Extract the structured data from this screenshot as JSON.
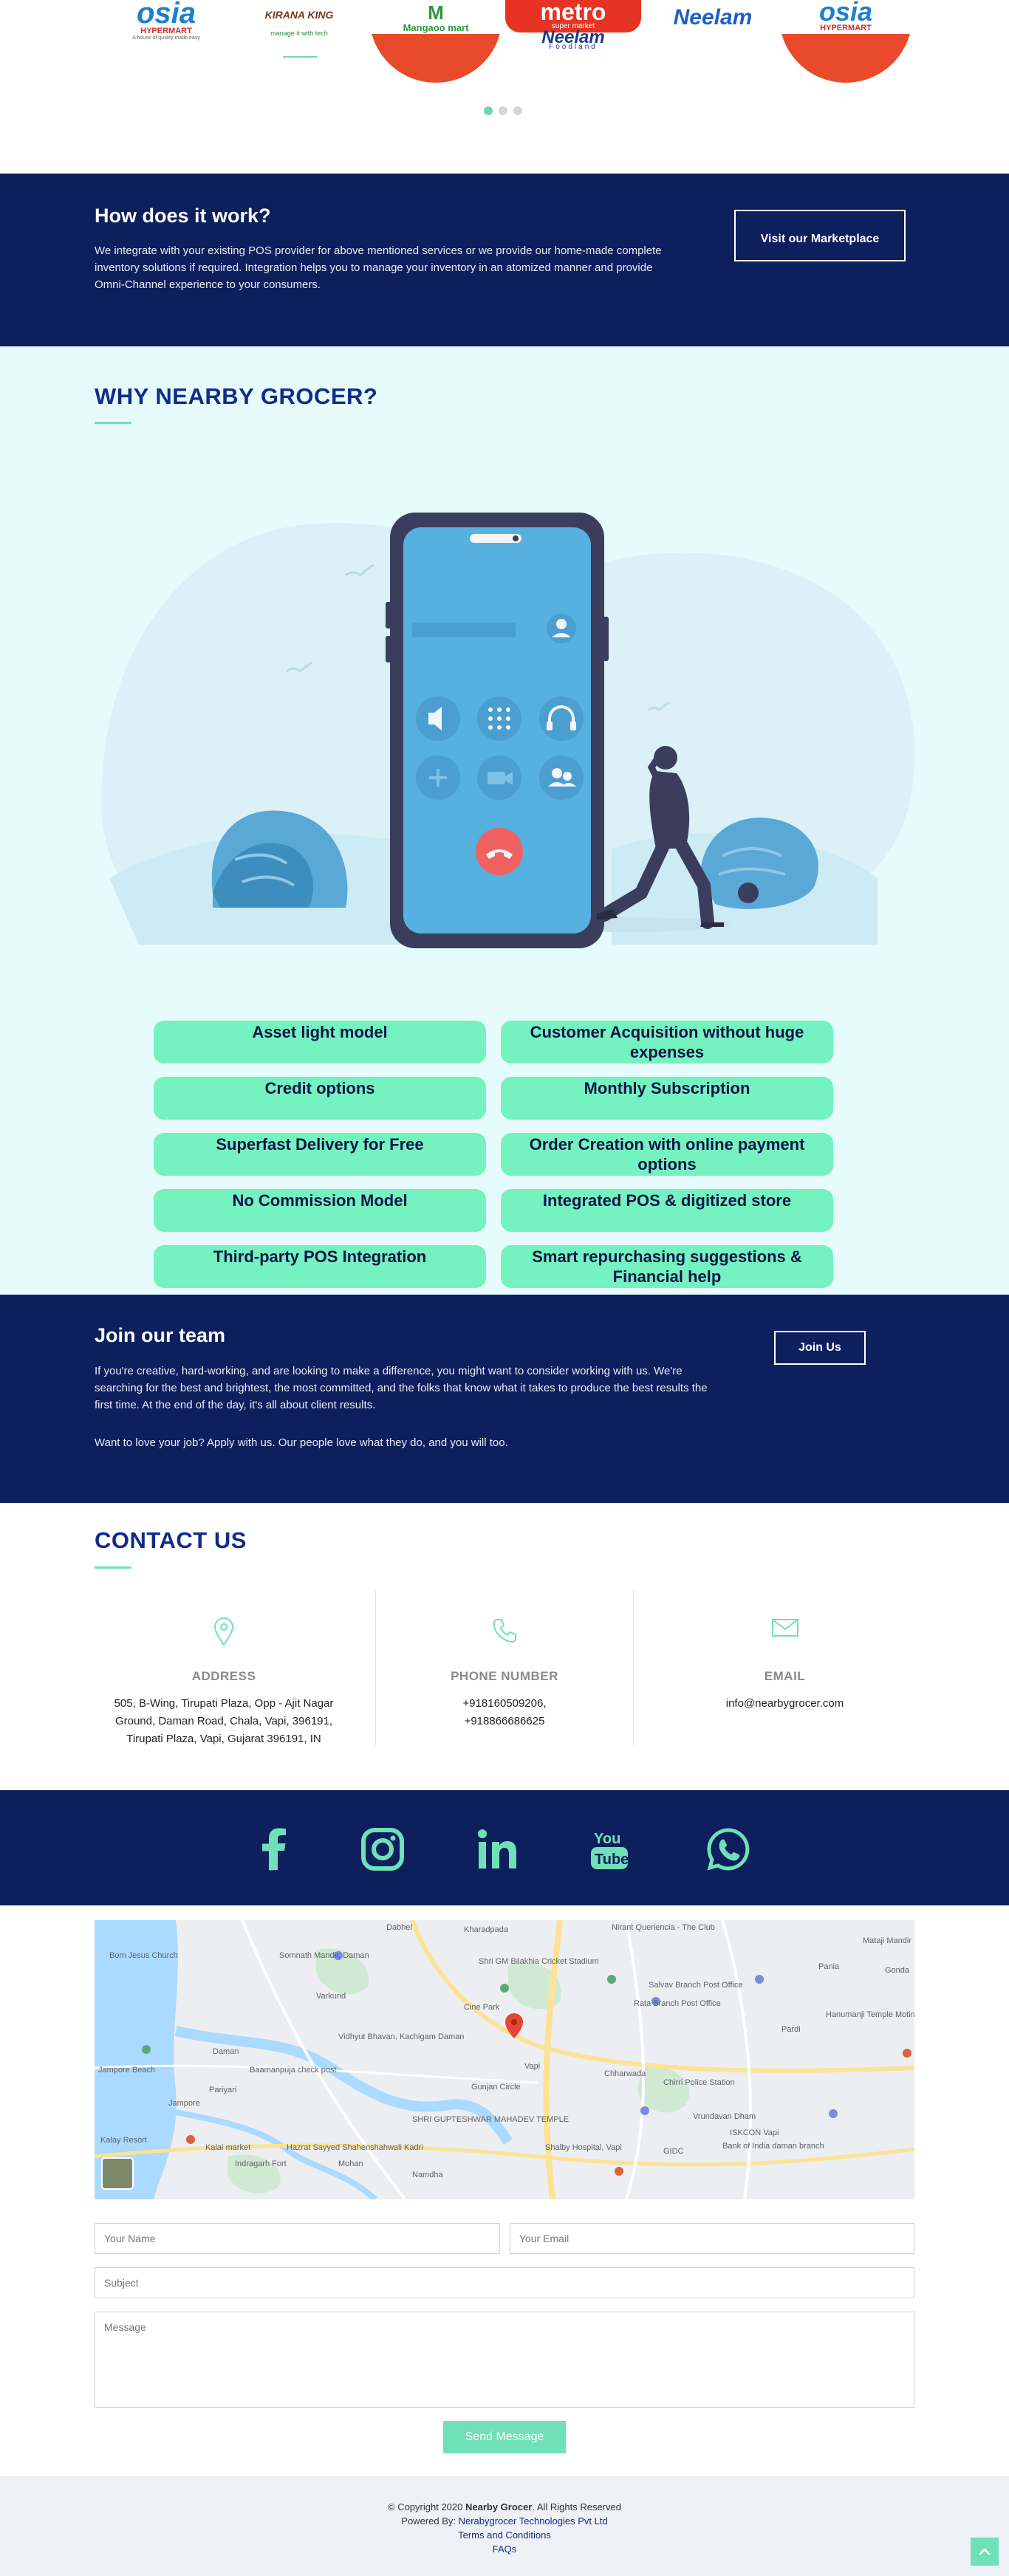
{
  "brands": [
    {
      "name": "osia",
      "sub": "HYPERMART",
      "tagline": "A house of quality made easy"
    },
    {
      "name": "KIRANA KING",
      "sub": "",
      "tagline": "manage it with tech"
    },
    {
      "name": "Mangaoo mart",
      "sub": "",
      "tagline": ""
    },
    {
      "name": "metro",
      "sub": "super market",
      "tagline": ""
    },
    {
      "name": "Neelam",
      "sub": "",
      "tagline": "Foodland"
    },
    {
      "name": "Neelam",
      "sub": "",
      "tagline": ""
    },
    {
      "name": "osia",
      "sub": "HYPERMART",
      "tagline": ""
    }
  ],
  "carousel": {
    "active_index": 0,
    "dot_count": 3
  },
  "how": {
    "title": "How does it work?",
    "body": "We integrate with your existing POS provider for above mentioned services or we provide our home-made complete inventory solutions if required. Integration helps you to manage your inventory in an atomized manner and provide Omni-Channel experience to your consumers.",
    "button": "Visit our Marketplace"
  },
  "why": {
    "title": "WHY NEARBY GROCER?",
    "features": [
      "Asset light model",
      "Customer Acquisition without huge expenses",
      "Credit options",
      "Monthly Subscription",
      "Superfast Delivery for Free",
      "Order Creation with online payment options",
      "No Commission Model",
      "Integrated POS & digitized store",
      "Third-party POS Integration",
      "Smart repurchasing suggestions & Financial help"
    ]
  },
  "join": {
    "title": "Join our team",
    "body1": "If you're creative, hard-working, and are looking to make a difference, you might want to consider working with us. We're searching for the best and brightest, the most committed, and the folks that know what it takes to produce the best results the first time. At the end of the day, it's all about client results.",
    "body2": "Want to love your job? Apply with us. Our people love what they do, and you will too.",
    "button": "Join Us"
  },
  "contact": {
    "title": "CONTACT US",
    "address_label": "ADDRESS",
    "address": "505, B-Wing, Tirupati Plaza, Opp - Ajit Nagar Ground, Daman Road, Chala, Vapi, 396191, Tirupati Plaza, Vapi, Gujarat 396191, IN",
    "phone_label": "PHONE NUMBER",
    "phone1": "+918160509206,",
    "phone2": "+918866686625",
    "email_label": "EMAIL",
    "email": "info@nearbygrocer.com"
  },
  "social": [
    "facebook-icon",
    "instagram-icon",
    "linkedin-icon",
    "youtube-icon",
    "whatsapp-icon"
  ],
  "map": {
    "labels": [
      "Bom Jesus Church",
      "Somnath Mandir, Daman",
      "Shri GM Bilakhia Cricket Stadium",
      "Salvav Branch Post Office",
      "Rata Branch Post Office",
      "Varkund",
      "Cine Park",
      "Vidhyut Bhavan, Kachigam Daman",
      "Daman",
      "Baamanpuja check post",
      "Pariyari",
      "Jampore",
      "Jampore Beach",
      "Gunjan Circle",
      "Vapi",
      "Chharwada",
      "Chirri Police Station",
      "Vrundavan Dham",
      "ISKCON Vapi",
      "Bank of India daman branch",
      "Pardi",
      "Hanumanji Temple Motinayakad Faliya",
      "Kalai market",
      "Hazrat Sayyed Shahenshahwali Kadri",
      "Indragarh Fort",
      "Mohan",
      "Namdha",
      "SHRI GUPTESHWAR MAHADEV TEMPLE",
      "Shalby Hospital, Vapi",
      "GIDC",
      "Kalay Resort",
      "Nirant Queriencia - The Club",
      "Pania",
      "Mataji Mandir",
      "Gonda",
      "Dabhel",
      "Kharadpada"
    ]
  },
  "form": {
    "name_placeholder": "Your Name",
    "email_placeholder": "Your Email",
    "subject_placeholder": "Subject",
    "message_placeholder": "Message",
    "send": "Send Message"
  },
  "footer": {
    "copyright_prefix": "© Copyright 2020",
    "brand": "Nearby Grocer",
    "copyright_suffix": ". All Rights Reserved",
    "powered_prefix": "Powered By:",
    "powered_company": "Nerabygrocer Technologies Pvt Ltd",
    "terms": "Terms and Conditions",
    "faqs": "FAQs"
  },
  "colors": {
    "navy": "#0d1f5c",
    "mint": "#74f2bf",
    "accent_green": "#6fe0b8",
    "title_blue": "#112b8a",
    "phone_blue": "#56b0e0",
    "light_bg": "#e6fbfb"
  }
}
